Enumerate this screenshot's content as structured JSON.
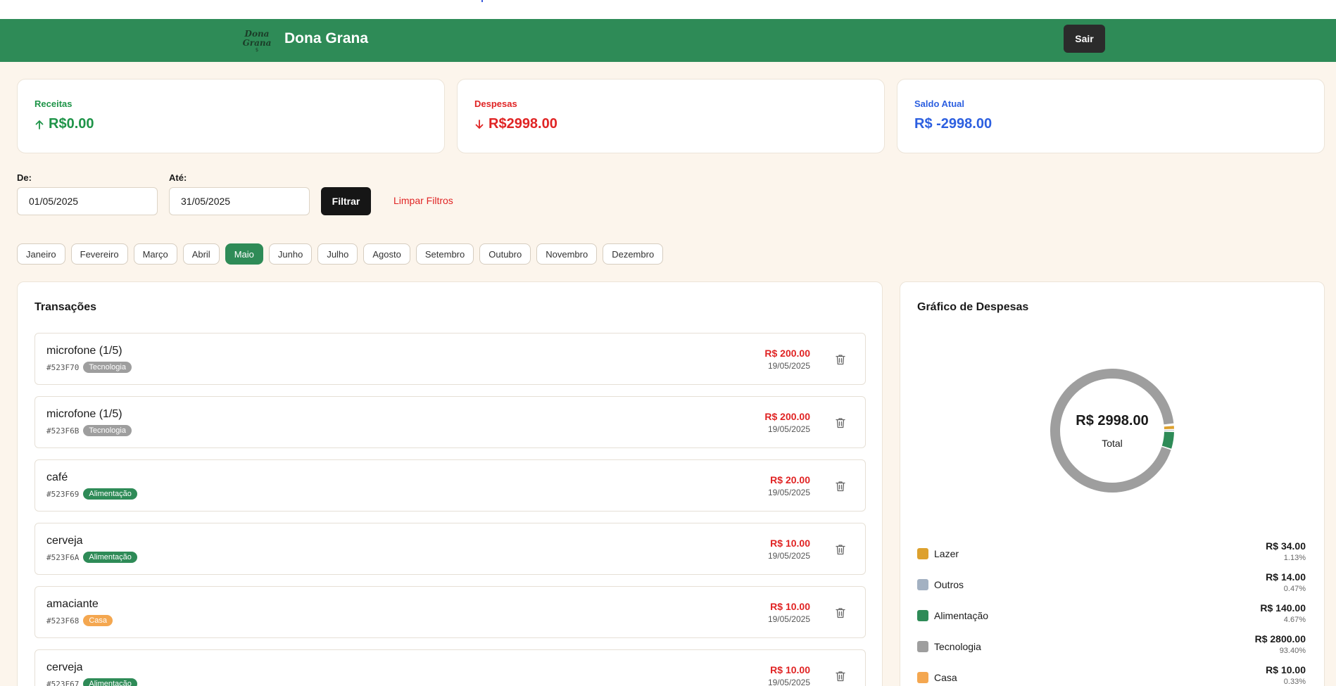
{
  "header": {
    "brand_name": "Dona Grana",
    "logo_text_top": "Dona",
    "logo_text_bottom": "Grana",
    "logout_label": "Sair",
    "color": "#2e8b57"
  },
  "summary": {
    "income": {
      "label": "Receitas",
      "value": "R$0.00",
      "icon": "arrow-up-icon",
      "color": "#1e9448"
    },
    "expenses": {
      "label": "Despesas",
      "value": "R$2998.00",
      "icon": "arrow-down-icon",
      "color": "#e02424"
    },
    "balance": {
      "label": "Saldo Atual",
      "value": "R$ -2998.00",
      "color": "#2c5fe0"
    }
  },
  "filters": {
    "from_label": "De:",
    "from_value": "01/05/2025",
    "to_label": "Até:",
    "to_value": "31/05/2025",
    "filter_button": "Filtrar",
    "clear_button": "Limpar Filtros"
  },
  "months": [
    {
      "label": "Janeiro",
      "active": false
    },
    {
      "label": "Fevereiro",
      "active": false
    },
    {
      "label": "Março",
      "active": false
    },
    {
      "label": "Abril",
      "active": false
    },
    {
      "label": "Maio",
      "active": true
    },
    {
      "label": "Junho",
      "active": false
    },
    {
      "label": "Julho",
      "active": false
    },
    {
      "label": "Agosto",
      "active": false
    },
    {
      "label": "Setembro",
      "active": false
    },
    {
      "label": "Outubro",
      "active": false
    },
    {
      "label": "Novembro",
      "active": false
    },
    {
      "label": "Dezembro",
      "active": false
    }
  ],
  "transactions": {
    "title": "Transações",
    "items": [
      {
        "name": "microfone (1/5)",
        "id": "#523F70",
        "category": "Tecnologia",
        "category_color": "#9e9e9e",
        "amount": "R$ 200.00",
        "date": "19/05/2025"
      },
      {
        "name": "microfone (1/5)",
        "id": "#523F6B",
        "category": "Tecnologia",
        "category_color": "#9e9e9e",
        "amount": "R$ 200.00",
        "date": "19/05/2025"
      },
      {
        "name": "café",
        "id": "#523F69",
        "category": "Alimentação",
        "category_color": "#2e8b57",
        "amount": "R$ 20.00",
        "date": "19/05/2025"
      },
      {
        "name": "cerveja",
        "id": "#523F6A",
        "category": "Alimentação",
        "category_color": "#2e8b57",
        "amount": "R$ 10.00",
        "date": "19/05/2025"
      },
      {
        "name": "amaciante",
        "id": "#523F68",
        "category": "Casa",
        "category_color": "#f4a750",
        "amount": "R$ 10.00",
        "date": "19/05/2025"
      },
      {
        "name": "cerveja",
        "id": "#523F67",
        "category": "Alimentação",
        "category_color": "#2e8b57",
        "amount": "R$ 10.00",
        "date": "19/05/2025"
      }
    ]
  },
  "chart": {
    "title": "Gráfico de Despesas",
    "total": "R$ 2998.00",
    "total_label": "Total"
  },
  "chart_data": {
    "type": "pie",
    "title": "Gráfico de Despesas",
    "total": 2998.0,
    "categories": [
      "Lazer",
      "Outros",
      "Alimentação",
      "Tecnologia",
      "Casa"
    ],
    "values": [
      34.0,
      14.0,
      140.0,
      2800.0,
      10.0
    ],
    "percentages": [
      1.13,
      0.47,
      4.67,
      93.4,
      0.33
    ],
    "colors": [
      "#dda12e",
      "#a3b1c2",
      "#2e8b57",
      "#9e9e9e",
      "#f4a750"
    ],
    "legend": [
      {
        "name": "Lazer",
        "amount": "R$ 34.00",
        "pct": "1.13%"
      },
      {
        "name": "Outros",
        "amount": "R$ 14.00",
        "pct": "0.47%"
      },
      {
        "name": "Alimentação",
        "amount": "R$ 140.00",
        "pct": "4.67%"
      },
      {
        "name": "Tecnologia",
        "amount": "R$ 2800.00",
        "pct": "93.40%"
      },
      {
        "name": "Casa",
        "amount": "R$ 10.00",
        "pct": "0.33%"
      }
    ]
  }
}
